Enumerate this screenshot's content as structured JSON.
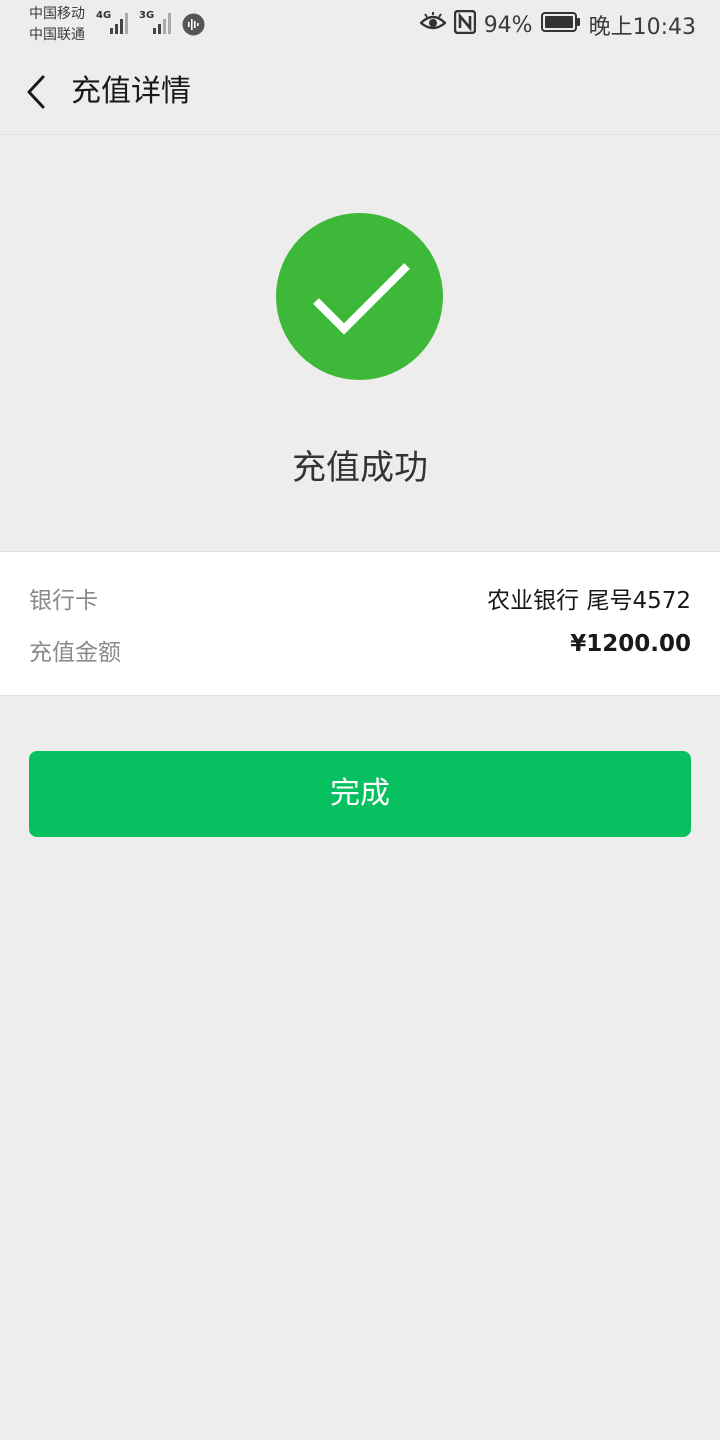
{
  "status_bar": {
    "carrier_1": "中国移动",
    "carrier_2": "中国联通",
    "network_1": "4G",
    "network_2": "3G",
    "battery_percent": "94%",
    "time": "晚上10:43",
    "icons": [
      "eye-icon",
      "nfc-icon",
      "battery-icon"
    ]
  },
  "nav": {
    "title": "充值详情",
    "back_icon": "chevron-left-icon"
  },
  "result": {
    "status_text": "充值成功",
    "icon": "check-circle-icon",
    "icon_color": "#3eb838"
  },
  "details": {
    "rows": [
      {
        "label": "银行卡",
        "value": "农业银行 尾号4572"
      },
      {
        "label": "充值金额",
        "value": "¥1200.00"
      }
    ]
  },
  "actions": {
    "done_label": "完成",
    "done_color": "#07c160"
  }
}
